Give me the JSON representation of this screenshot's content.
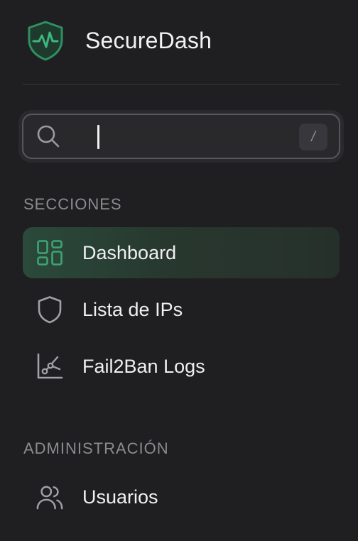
{
  "brand": {
    "name": "SecureDash",
    "logo_icon": "shield-pulse-icon",
    "accent_color": "#2f8f62"
  },
  "search": {
    "value": "",
    "placeholder": "",
    "shortcut_key": "/"
  },
  "sections": [
    {
      "label": "SECCIONES",
      "items": [
        {
          "label": "Dashboard",
          "icon": "grid-icon",
          "active": true
        },
        {
          "label": "Lista de IPs",
          "icon": "shield-icon",
          "active": false
        },
        {
          "label": "Fail2Ban Logs",
          "icon": "chart-icon",
          "active": false
        }
      ]
    },
    {
      "label": "ADMINISTRACIÓN",
      "items": [
        {
          "label": "Usuarios",
          "icon": "users-icon",
          "active": false
        }
      ]
    }
  ],
  "colors": {
    "background": "#1f1f21",
    "active_item_bg": "#2a4a3b",
    "active_icon": "#3fa374",
    "muted_text": "#8b8b90"
  }
}
